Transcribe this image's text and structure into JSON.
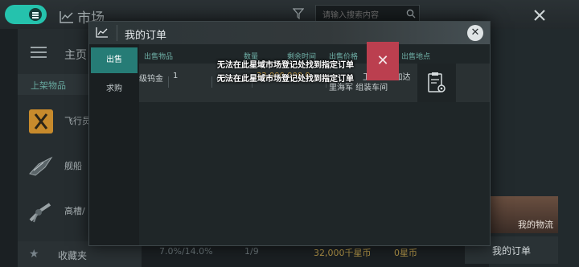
{
  "header": {
    "title": "市场",
    "search_placeholder": "请输入搜索内容"
  },
  "sidebar": {
    "home_label": "主页",
    "section_label": "上架物品",
    "items": [
      {
        "label": "飞行员"
      },
      {
        "label": "舰船"
      },
      {
        "label": "高槽/"
      }
    ],
    "favorites_label": "收藏夹"
  },
  "footer": {
    "tax": "7.0%/14.0%",
    "orders_count": "1/9",
    "balance": "32,000千星币",
    "fee": "0星币"
  },
  "right_panel": {
    "logistics_label": "我的物流",
    "my_orders_button": "我的订单"
  },
  "modal": {
    "title": "我的订单",
    "tabs": [
      {
        "label": "出售",
        "active": true
      },
      {
        "label": "求购",
        "active": false
      }
    ],
    "columns": [
      "出售物品",
      "数量",
      "剩余时间",
      "出售价格",
      "出售地点"
    ],
    "rows": [
      {
        "item": "级钨金",
        "quantity": "1",
        "remaining": "6天",
        "price": "32,000,000.0",
        "location_line1": "卫星 4 - 加达",
        "location_line2": "里海军 组装车间"
      }
    ],
    "error_lines": [
      "无法在此星域市场登记处找到指定订单",
      "无法在此星域市场登记处找到指定订单"
    ]
  },
  "colors": {
    "accent": "#25c2ad",
    "tab_active": "#267c76",
    "delete": "#bb3f4f",
    "price": "#d8a849"
  }
}
